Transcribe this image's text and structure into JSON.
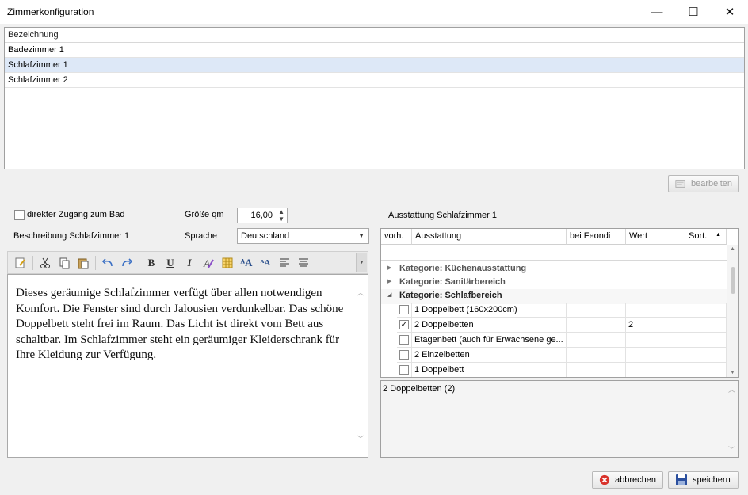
{
  "window": {
    "title": "Zimmerkonfiguration",
    "minimize": "—",
    "maximize": "☐",
    "close": "✕"
  },
  "rooms": {
    "header": "Bezeichnung",
    "rows": [
      "Badezimmer 1",
      "Schlafzimmer 1",
      "Schlafzimmer 2"
    ],
    "selected_index": 1
  },
  "edit_button": {
    "label": "bearbeiten"
  },
  "form": {
    "direct_bath_label": "direkter Zugang zum Bad",
    "direct_bath_checked": false,
    "size_label": "Größe qm",
    "size_value": "16,00",
    "desc_label": "Beschreibung Schlafzimmer 1",
    "lang_label": "Sprache",
    "lang_value": "Deutschland"
  },
  "editor": {
    "text": "Dieses geräumige Schlafzimmer verfügt über allen notwendigen Komfort. Die Fenster sind durch Jalousien verdunkelbar. Das schöne Doppelbett steht frei im Raum. Das Licht ist direkt vom Bett aus schaltbar. Im Schlafzimmer steht ein geräumiger Kleiderschrank für Ihre Kleidung zur Verfügung.",
    "toolbar": {
      "bold": "B",
      "underline": "U",
      "italic": "I",
      "grow": "ᴬA",
      "shrink": "ᴬA"
    }
  },
  "equipment": {
    "title": "Ausstattung Schlafzimmer 1",
    "columns": [
      "vorh.",
      "Ausstattung",
      "bei Feondi",
      "Wert",
      "Sort."
    ],
    "categories": [
      {
        "label": "Kategorie: Küchenausstattung",
        "expanded": false
      },
      {
        "label": "Kategorie: Sanitärbereich",
        "expanded": false
      },
      {
        "label": "Kategorie: Schlafbereich",
        "expanded": true
      }
    ],
    "items": [
      {
        "checked": false,
        "name": "1 Doppelbett (160x200cm)",
        "value": ""
      },
      {
        "checked": true,
        "name": "2 Doppelbetten",
        "value": "2"
      },
      {
        "checked": false,
        "name": "Etagenbett (auch für Erwachsene ge...",
        "value": ""
      },
      {
        "checked": false,
        "name": "2 Einzelbetten",
        "value": ""
      },
      {
        "checked": false,
        "name": "1 Doppelbett",
        "value": ""
      }
    ],
    "summary": "2 Doppelbetten (2)"
  },
  "footer": {
    "cancel": "abbrechen",
    "save": "speichern"
  },
  "colors": {
    "selected_row": "#dde8f7",
    "cancel_icon": "#d9322b",
    "save_icon": "#2b4f9e"
  }
}
